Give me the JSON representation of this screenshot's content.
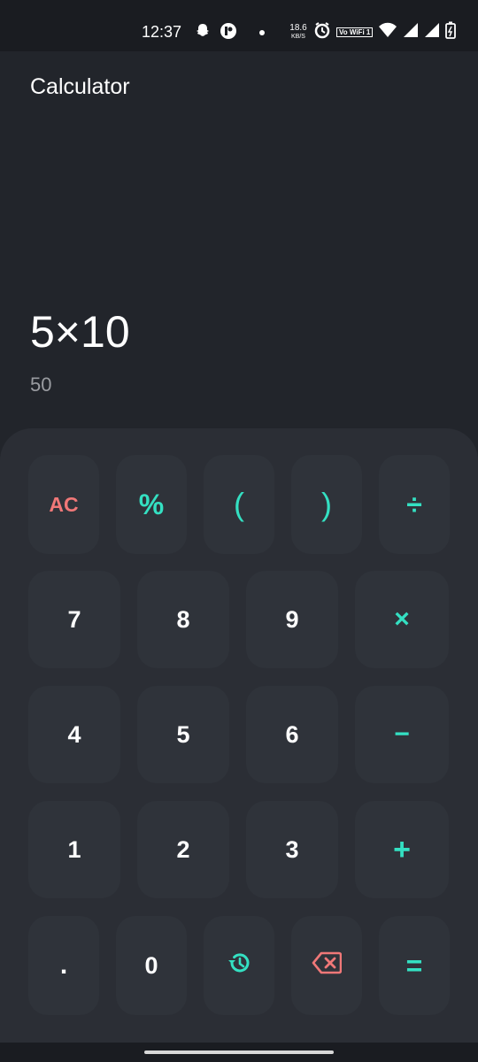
{
  "status_bar": {
    "time": "12:37",
    "net_speed": "18.6",
    "net_speed_unit": "KB/S",
    "volte_label": "Vo WiFi 1"
  },
  "app": {
    "title": "Calculator"
  },
  "display": {
    "expression": "5×10",
    "result": "50"
  },
  "keys": {
    "ac": "AC",
    "percent": "%",
    "open_paren": "(",
    "close_paren": ")",
    "divide": "÷",
    "seven": "7",
    "eight": "8",
    "nine": "9",
    "multiply": "×",
    "four": "4",
    "five": "5",
    "six": "6",
    "minus": "−",
    "one": "1",
    "two": "2",
    "three": "3",
    "plus": "+",
    "dot": ".",
    "zero": "0",
    "equals": "="
  },
  "icons": {
    "history": "history-icon",
    "backspace": "backspace-icon"
  },
  "colors": {
    "accent": "#34e0c2",
    "clear": "#f07878",
    "background": "#22252b",
    "keypad": "#2b2e35"
  }
}
